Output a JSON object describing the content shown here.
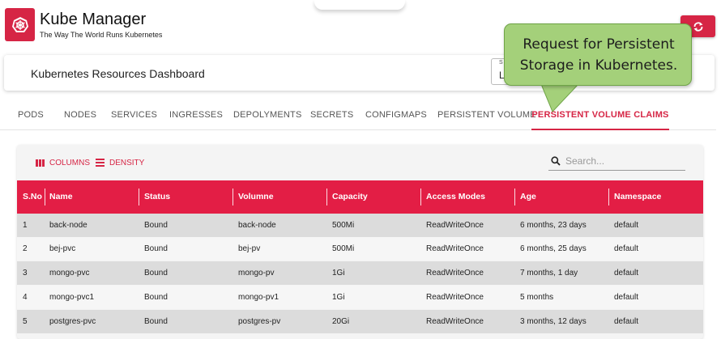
{
  "app": {
    "title": "Kube Manager",
    "subtitle": "The Way The World Runs Kubernetes"
  },
  "header": {
    "dashboard_title": "Kubernetes Resources Dashboard",
    "select_label": "S",
    "select_value": "L"
  },
  "tabs": [
    {
      "label": "PODS"
    },
    {
      "label": "NODES"
    },
    {
      "label": "SERVICES"
    },
    {
      "label": "INGRESSES"
    },
    {
      "label": "DEPOLYMENTS"
    },
    {
      "label": "SECRETS"
    },
    {
      "label": "CONFIGMAPS"
    },
    {
      "label": "PERSISTENT VOLUME"
    },
    {
      "label": "PERSISTENT VOLUME CLAIMS",
      "active": true
    }
  ],
  "toolbar": {
    "columns_label": "COLUMNS",
    "density_label": "DENSITY",
    "search_placeholder": "Search..."
  },
  "table": {
    "columns": [
      "S.No",
      "Name",
      "Status",
      "Volumne",
      "Capacity",
      "Access Modes",
      "Age",
      "Namespace"
    ],
    "rows": [
      [
        "1",
        "back-node",
        "Bound",
        "back-node",
        "500Mi",
        "ReadWriteOnce",
        "6 months, 23 days",
        "default"
      ],
      [
        "2",
        "bej-pvc",
        "Bound",
        "bej-pv",
        "500Mi",
        "ReadWriteOnce",
        "6 months, 25 days",
        "default"
      ],
      [
        "3",
        "mongo-pvc",
        "Bound",
        "mongo-pv",
        "1Gi",
        "ReadWriteOnce",
        "7 months, 1 day",
        "default"
      ],
      [
        "4",
        "mongo-pvc1",
        "Bound",
        "mongo-pv1",
        "1Gi",
        "ReadWriteOnce",
        "5 months",
        "default"
      ],
      [
        "5",
        "postgres-pvc",
        "Bound",
        "postgres-pv",
        "20Gi",
        "ReadWriteOnce",
        "3 months, 12 days",
        "default"
      ]
    ]
  },
  "callout": {
    "line1": "Request for Persistent",
    "line2": "Storage in Kubernetes."
  },
  "colors": {
    "accent": "#d62545",
    "header_row": "#e31e45",
    "callout": "#a4d07a"
  },
  "icons": {
    "logo": "kubernetes-helm-icon",
    "refresh": "refresh-icon",
    "columns": "columns-icon",
    "density": "density-icon",
    "search": "search-icon"
  }
}
